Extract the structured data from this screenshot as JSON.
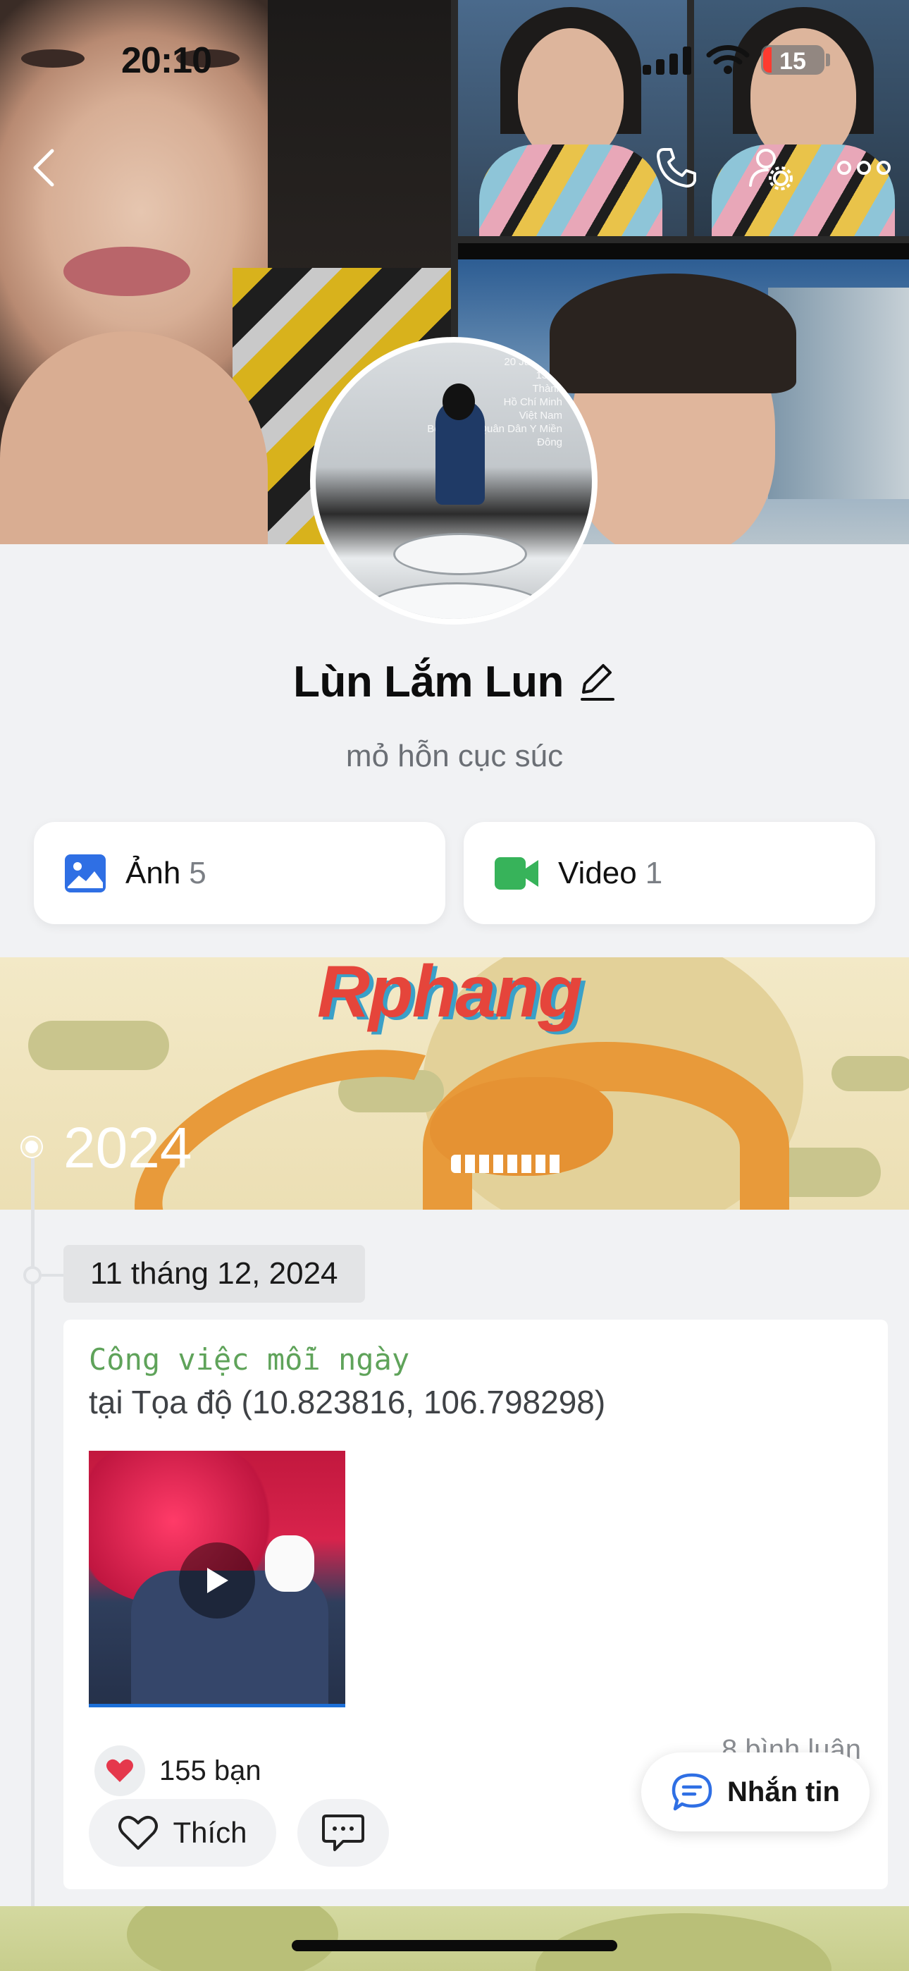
{
  "status_bar": {
    "time": "20:10",
    "battery": "15"
  },
  "cover": {
    "avatar_caption": "20 Jun 2024\n13:24\nThành\nHồ Chí Minh\nViệt Nam\nBệnh Viện Quân Dân Y Miền Đông"
  },
  "profile": {
    "name": "Lùn Lắm Lun",
    "bio": "mỏ hỗn cục súc"
  },
  "media": {
    "photos": {
      "label": "Ảnh",
      "count": "5",
      "icon": "photo-icon",
      "color": "#2f6fe4"
    },
    "videos": {
      "label": "Video",
      "count": "1",
      "icon": "video-camera-icon",
      "color": "#37b35a"
    }
  },
  "banner": {
    "watermark": "Rphang",
    "year": "2024"
  },
  "timeline": {
    "date": "11 tháng 12, 2024",
    "post": {
      "title": "Công việc mỗi ngày",
      "location": "tại Tọa độ (10.823816, 106.798298)",
      "reactions": "155 bạn",
      "comments": "8 bình luận",
      "like_label": "Thích"
    }
  },
  "message_button": {
    "label": "Nhắn tin"
  },
  "colors": {
    "accent_blue": "#2f6fe4",
    "accent_green": "#5fa35a",
    "background": "#f1f2f4",
    "heart": "#e5384c"
  }
}
